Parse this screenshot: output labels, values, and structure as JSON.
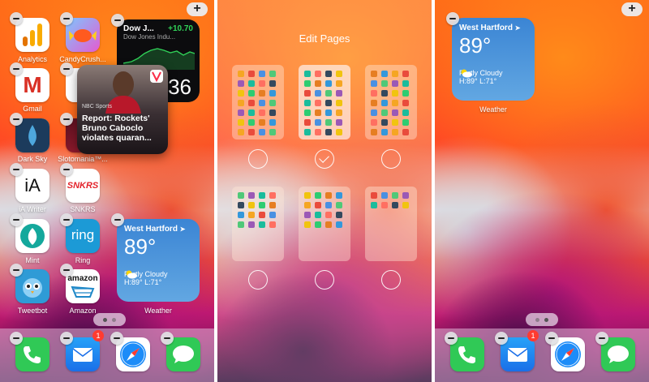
{
  "panel1": {
    "apps": {
      "analytics": "Analytics",
      "candy": "CandyCrush...",
      "gmail": "Gmail",
      "darksky": "Dark Sky",
      "slotomania": "Slotomania™...",
      "iawriter": "iA Writer",
      "snkrs": "SNKRS",
      "mint": "Mint",
      "ring": "Ring",
      "tweetbot": "Tweetbot",
      "amazon": "Amazon"
    },
    "stocks": {
      "ticker": "Dow J...",
      "change": "+10.70",
      "name": "Dow Jones Indu...",
      "value": "36"
    },
    "news": {
      "source": "NBC Sports",
      "headline": "Report: Rockets' Bruno Caboclo violates quaran..."
    },
    "weather": {
      "city": "West Hartford",
      "temp": "89°",
      "condition": "Partly Cloudy",
      "hilo": "H:89° L:71°",
      "label": "Weather"
    },
    "dock_badge": "1"
  },
  "panel2": {
    "title": "Edit Pages"
  },
  "panel3": {
    "weather": {
      "city": "West Hartford",
      "temp": "89°",
      "condition": "Partly Cloudy",
      "hilo": "H:89° L:71°",
      "label": "Weather"
    },
    "dock_badge": "1"
  },
  "glyphs": {
    "plus": "+",
    "ia": "iA",
    "snkrs": "SNKRS",
    "ring": "ring",
    "amazon": "amazon",
    "gmail": "M"
  },
  "colors": {
    "weather_top": "#3b85d4",
    "weather_bottom": "#62a7e2",
    "stocks_green": "#30d158",
    "badge_red": "#ff3b30",
    "checkmark": "#ffffff"
  }
}
